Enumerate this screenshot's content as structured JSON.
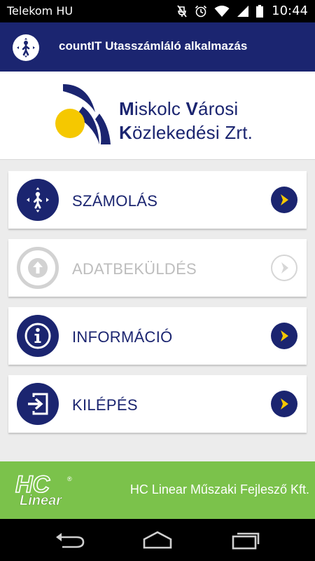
{
  "status_bar": {
    "carrier": "Telekom HU",
    "time": "10:44",
    "icons": [
      "mute-icon",
      "alarm-icon",
      "wifi-icon",
      "signal-icon",
      "battery-icon"
    ]
  },
  "app_bar": {
    "title": "countIT Utasszámláló alkalmazás",
    "logo_icon": "person-walking-icon"
  },
  "brand": {
    "line1_cap": "M",
    "line1_rest": "iskolc ",
    "line1_cap2": "V",
    "line1_rest2": "árosi",
    "line2_cap": "K",
    "line2_rest": "özlekedési Zrt.",
    "logo_color": "#1b2570",
    "sun_color": "#f5c800"
  },
  "menu": {
    "items": [
      {
        "label": "SZÁMOLÁS",
        "icon": "counting-person-icon",
        "enabled": true
      },
      {
        "label": "ADATBEKÜLDÉS",
        "icon": "upload-arrow-icon",
        "enabled": false
      },
      {
        "label": "INFORMÁCIÓ",
        "icon": "info-icon",
        "enabled": true
      },
      {
        "label": "KILÉPÉS",
        "icon": "exit-icon",
        "enabled": true
      }
    ],
    "arrow_icon": "chevron-right-icon",
    "accent_color": "#f5c800",
    "primary_color": "#1b2570"
  },
  "footer": {
    "logo_text_top": "HC",
    "logo_text_bottom": "Linear",
    "logo_reg": "®",
    "company": "HC Linear Műszaki Fejlesző Kft.",
    "color": "#7bc24b"
  },
  "nav_bar": {
    "buttons": [
      "back-icon",
      "home-icon",
      "recent-apps-icon"
    ]
  }
}
